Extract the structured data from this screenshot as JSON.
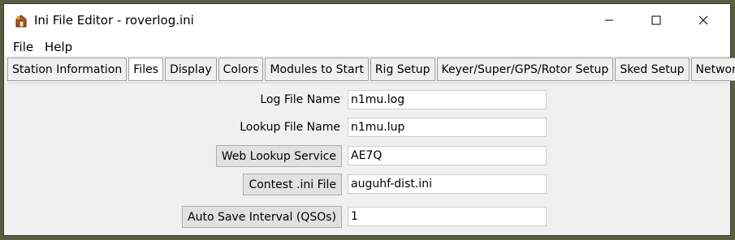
{
  "window": {
    "title": "Ini File Editor - roverlog.ini"
  },
  "icons": {
    "app": "app-icon",
    "minimize": "minimize-icon",
    "maximize": "maximize-icon",
    "close": "close-icon"
  },
  "menu": {
    "file": "File",
    "help": "Help"
  },
  "tabs": [
    {
      "label": "Station Information"
    },
    {
      "label": "Files",
      "selected": true
    },
    {
      "label": "Display"
    },
    {
      "label": "Colors"
    },
    {
      "label": "Modules to Start"
    },
    {
      "label": "Rig Setup"
    },
    {
      "label": "Keyer/Super/GPS/Rotor Setup"
    },
    {
      "label": "Sked Setup"
    },
    {
      "label": "Networking"
    }
  ],
  "fields": {
    "log_file": {
      "label": "Log File Name",
      "value": "n1mu.log"
    },
    "lookup_file": {
      "label": "Lookup File Name",
      "value": "n1mu.lup"
    },
    "web_lookup": {
      "label": "Web Lookup Service",
      "value": "AE7Q"
    },
    "contest_ini": {
      "label": "Contest .ini File",
      "value": "auguhf-dist.ini"
    },
    "auto_save": {
      "label": "Auto Save Interval (QSOs)",
      "value": "1"
    }
  }
}
